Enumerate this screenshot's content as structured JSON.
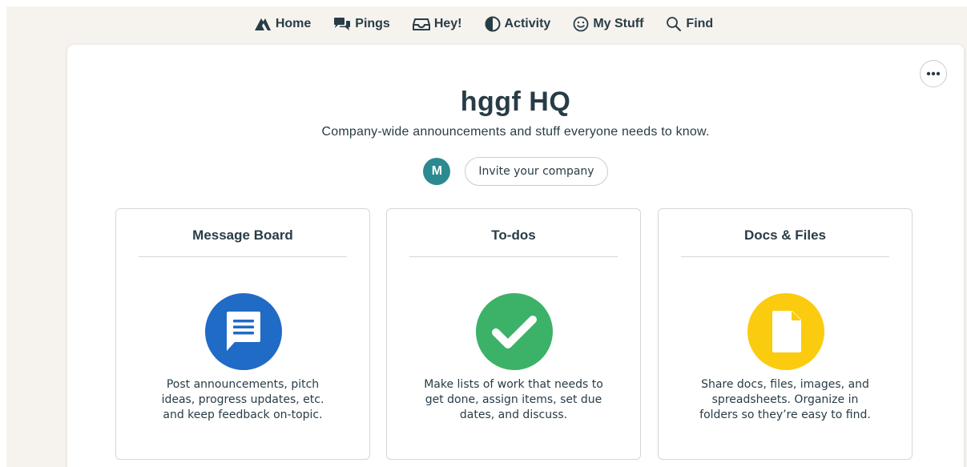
{
  "nav": {
    "items": [
      {
        "label": "Home",
        "icon": "basecamp-mountain-icon"
      },
      {
        "label": "Pings",
        "icon": "chat-bubbles-icon"
      },
      {
        "label": "Hey!",
        "icon": "inbox-tray-icon"
      },
      {
        "label": "Activity",
        "icon": "half-circle-icon"
      },
      {
        "label": "My Stuff",
        "icon": "smiley-face-icon"
      },
      {
        "label": "Find",
        "icon": "magnifier-icon"
      }
    ]
  },
  "project": {
    "title": "hggf HQ",
    "description": "Company-wide announcements and stuff everyone needs to know.",
    "avatar_initial": "M",
    "invite_label": "Invite your company",
    "more_icon": "ellipsis-icon"
  },
  "tools": [
    {
      "title": "Message Board",
      "icon": "message-board-icon",
      "color": "#1f6bc6",
      "desc_lines": [
        "Post announcements, pitch",
        "ideas, progress updates, etc.",
        "and keep feedback on-topic."
      ]
    },
    {
      "title": "To-dos",
      "icon": "checkmark-icon",
      "color": "#3cb168",
      "desc_lines": [
        "Make lists of work that needs to",
        "get done, assign items, set due",
        "dates, and discuss."
      ]
    },
    {
      "title": "Docs & Files",
      "icon": "document-icon",
      "color": "#fbcb0f",
      "desc_lines": [
        "Share docs, files, images, and",
        "spreadsheets. Organize in",
        "folders so they’re easy to find."
      ]
    }
  ],
  "colors": {
    "background": "#f6f3ef",
    "text": "#283c46",
    "avatar": "#2b8a8f"
  }
}
